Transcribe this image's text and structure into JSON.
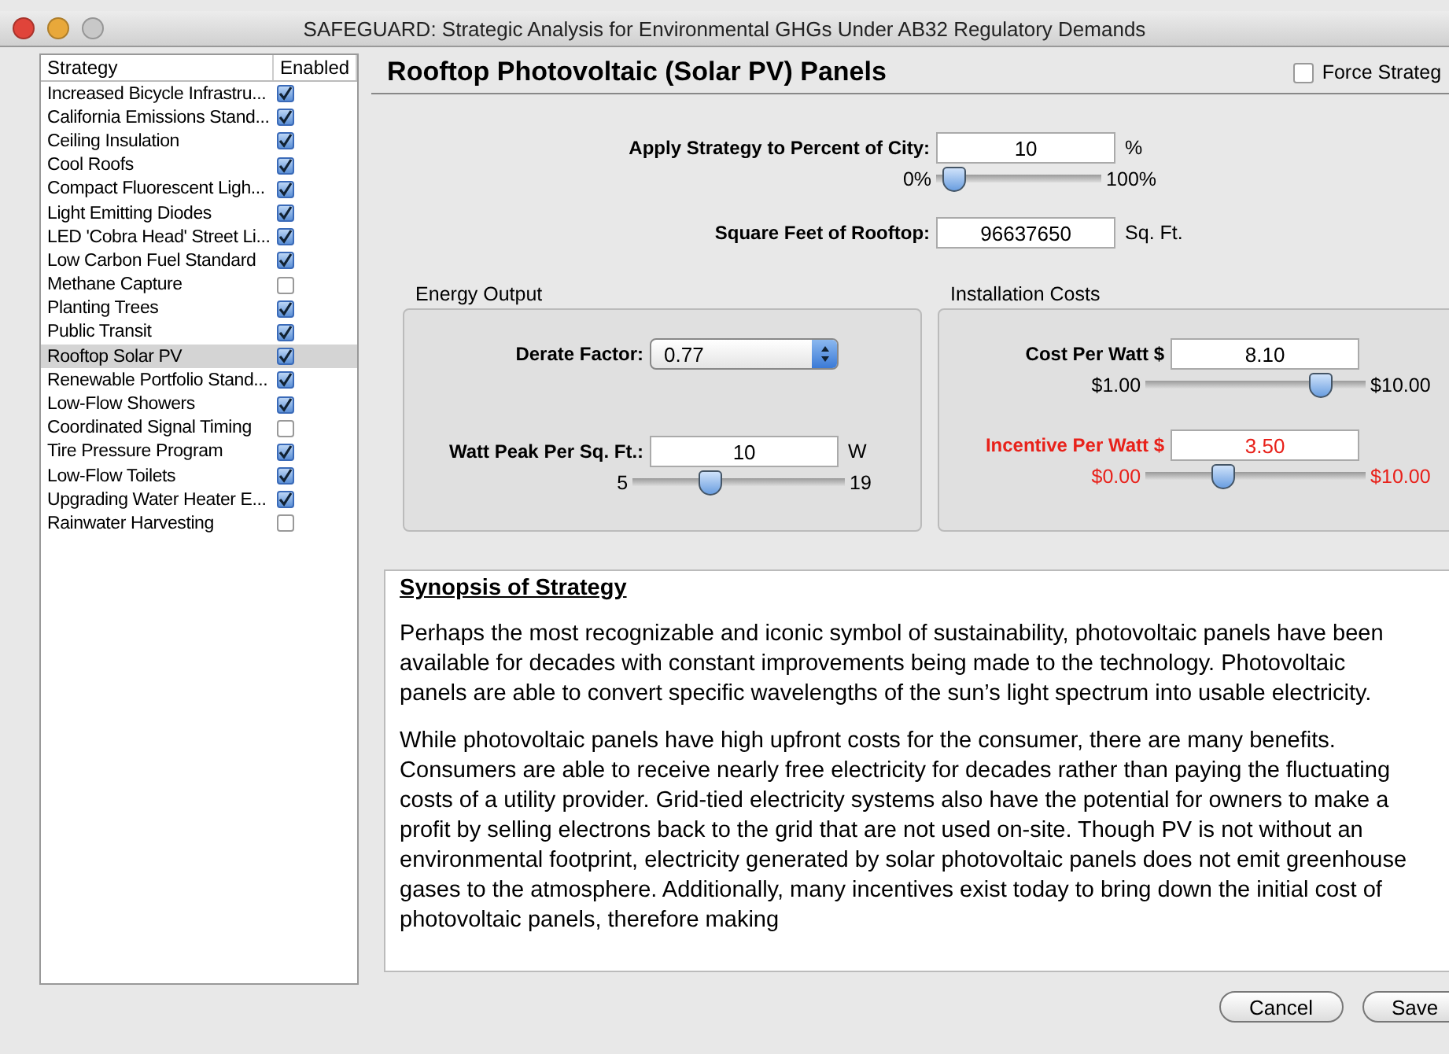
{
  "window": {
    "title": "SAFEGUARD: Strategic Analysis for Environmental GHGs Under AB32 Regulatory Demands"
  },
  "strategy_list": {
    "columns": [
      "Strategy",
      "Enabled"
    ],
    "rows": [
      {
        "name": "Increased Bicycle Infrastru...",
        "enabled": true,
        "selected": false
      },
      {
        "name": "California Emissions Stand...",
        "enabled": true,
        "selected": false
      },
      {
        "name": "Ceiling Insulation",
        "enabled": true,
        "selected": false
      },
      {
        "name": "Cool Roofs",
        "enabled": true,
        "selected": false
      },
      {
        "name": "Compact Fluorescent Ligh...",
        "enabled": true,
        "selected": false
      },
      {
        "name": "Light Emitting Diodes",
        "enabled": true,
        "selected": false
      },
      {
        "name": "LED 'Cobra Head' Street Li...",
        "enabled": true,
        "selected": false
      },
      {
        "name": "Low Carbon Fuel Standard",
        "enabled": true,
        "selected": false
      },
      {
        "name": "Methane Capture",
        "enabled": false,
        "selected": false
      },
      {
        "name": "Planting Trees",
        "enabled": true,
        "selected": false
      },
      {
        "name": "Public Transit",
        "enabled": true,
        "selected": false
      },
      {
        "name": "Rooftop Solar PV",
        "enabled": true,
        "selected": true
      },
      {
        "name": "Renewable Portfolio Stand...",
        "enabled": true,
        "selected": false
      },
      {
        "name": "Low-Flow Showers",
        "enabled": true,
        "selected": false
      },
      {
        "name": "Coordinated Signal Timing",
        "enabled": false,
        "selected": false
      },
      {
        "name": "Tire Pressure Program",
        "enabled": true,
        "selected": false
      },
      {
        "name": "Low-Flow Toilets",
        "enabled": true,
        "selected": false
      },
      {
        "name": "Upgrading Water Heater E...",
        "enabled": true,
        "selected": false
      },
      {
        "name": "Rainwater Harvesting",
        "enabled": false,
        "selected": false
      }
    ]
  },
  "detail": {
    "title": "Rooftop Photovoltaic (Solar PV) Panels",
    "force_strategy": {
      "label": "Force Strateg",
      "checked": false
    },
    "percent_of_city": {
      "label": "Apply Strategy to Percent of City:",
      "value": "10",
      "unit": "%",
      "min_label": "0%",
      "max_label": "100%",
      "level": 0.1
    },
    "square_feet": {
      "label": "Square Feet of Rooftop:",
      "value": "96637650",
      "unit": "Sq. Ft."
    },
    "energy_output": {
      "title": "Energy Output",
      "derate_factor": {
        "label": "Derate Factor:",
        "value": "0.77"
      },
      "watt_peak": {
        "label": "Watt Peak Per Sq. Ft.:",
        "value": "10",
        "unit": "W",
        "min_label": "5",
        "max_label": "19",
        "level": 0.36
      }
    },
    "installation_costs": {
      "title": "Installation Costs",
      "fields": [
        {
          "label": "Cost Per Watt $",
          "value": "8.10",
          "min_label": "$1.00",
          "max_label": "$10.00",
          "level": 0.79,
          "alert": false
        },
        {
          "label": "Incentive Per Watt $",
          "value": "3.50",
          "min_label": "$0.00",
          "max_label": "$10.00",
          "level": 0.35,
          "alert": true
        }
      ]
    },
    "synopsis": {
      "heading": "Synopsis of Strategy",
      "paragraphs": [
        "Perhaps the most recognizable and iconic symbol of sustainability, photovoltaic panels have been available for decades with constant improvements being made to the technology. Photovoltaic panels are able to convert specific wavelengths of the sun’s light spectrum into usable electricity.",
        "While photovoltaic panels have high upfront costs for the consumer, there are many benefits. Consumers are able to receive nearly free electricity for decades rather than paying the fluctuating costs of a utility provider. Grid-tied electricity systems also have the potential for owners to make a profit by selling electrons back to the grid that are not used on-site. Though PV is not without an environmental footprint, electricity generated by solar photovoltaic panels does not emit greenhouse gases to the atmosphere. Additionally, many incentives exist today to bring down the initial cost of photovoltaic panels, therefore making"
      ]
    }
  },
  "buttons": [
    "Cancel",
    "Save"
  ]
}
